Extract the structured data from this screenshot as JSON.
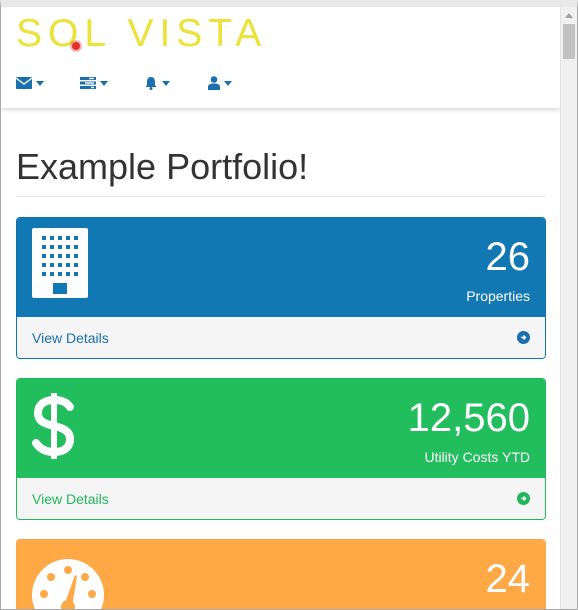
{
  "brand": {
    "logo_text_left": "S",
    "logo_text_o": "O",
    "logo_text_right": "L VISTA"
  },
  "nav": {
    "items": [
      {
        "icon": "envelope-icon"
      },
      {
        "icon": "tasks-icon"
      },
      {
        "icon": "bell-icon"
      },
      {
        "icon": "user-icon"
      }
    ]
  },
  "page": {
    "title": "Example Portfolio!"
  },
  "panels": [
    {
      "value": "26",
      "label": "Properties",
      "footer": "View Details",
      "icon": "building-icon",
      "color": "#1178b4"
    },
    {
      "value": "12,560",
      "label": "Utility Costs YTD",
      "footer": "View Details",
      "icon": "dollar-icon",
      "color": "#22be5d"
    },
    {
      "value": "24",
      "label": "",
      "footer": "",
      "icon": "dashboard-gauge-icon",
      "color": "#ffa846"
    }
  ],
  "colors": {
    "brand_yellow": "#ebe23a",
    "link_blue": "#1a6fae"
  }
}
